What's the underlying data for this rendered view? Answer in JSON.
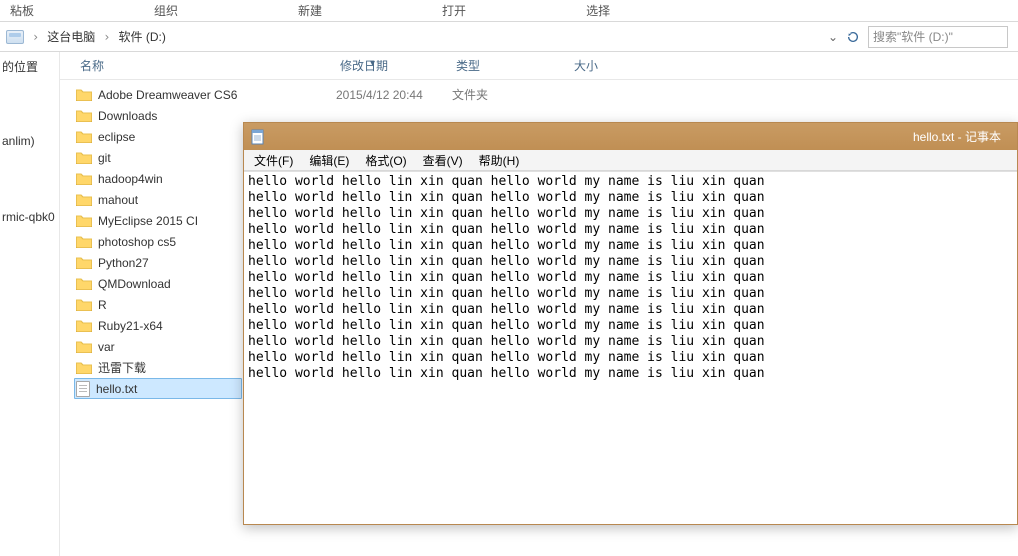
{
  "ribbon": [
    "粘板",
    "组织",
    "新建",
    "打开",
    "选择"
  ],
  "breadcrumb": {
    "a": "这台电脑",
    "b": "软件 (D:)"
  },
  "search_placeholder": "搜索\"软件 (D:)\"",
  "columns": {
    "name": "名称",
    "date": "修改日期",
    "type": "类型",
    "size": "大小"
  },
  "files": [
    {
      "name": "Adobe Dreamweaver CS6",
      "date": "2015/4/12 20:44",
      "type": "文件夹",
      "kind": "folder"
    },
    {
      "name": "Downloads",
      "date": "",
      "type": "",
      "kind": "folder"
    },
    {
      "name": "eclipse",
      "date": "",
      "type": "",
      "kind": "folder"
    },
    {
      "name": "git",
      "date": "",
      "type": "",
      "kind": "folder"
    },
    {
      "name": "hadoop4win",
      "date": "",
      "type": "",
      "kind": "folder"
    },
    {
      "name": "mahout",
      "date": "",
      "type": "",
      "kind": "folder"
    },
    {
      "name": "MyEclipse 2015 CI",
      "date": "",
      "type": "",
      "kind": "folder"
    },
    {
      "name": "photoshop cs5",
      "date": "",
      "type": "",
      "kind": "folder"
    },
    {
      "name": "Python27",
      "date": "",
      "type": "",
      "kind": "folder"
    },
    {
      "name": "QMDownload",
      "date": "",
      "type": "",
      "kind": "folder"
    },
    {
      "name": "R",
      "date": "",
      "type": "",
      "kind": "folder"
    },
    {
      "name": "Ruby21-x64",
      "date": "",
      "type": "",
      "kind": "folder"
    },
    {
      "name": "var",
      "date": "",
      "type": "",
      "kind": "folder"
    },
    {
      "name": "迅雷下载",
      "date": "",
      "type": "",
      "kind": "folder"
    },
    {
      "name": "hello.txt",
      "date": "",
      "type": "",
      "kind": "file",
      "selected": true
    }
  ],
  "leftnav": [
    "的位置",
    "anlim)",
    "rmic-qbk0"
  ],
  "notepad": {
    "title": "hello.txt - 记事本",
    "menu": [
      "文件(F)",
      "编辑(E)",
      "格式(O)",
      "查看(V)",
      "帮助(H)"
    ],
    "line": "hello world hello lin xin quan hello world my name is liu xin quan",
    "line_count": 13
  }
}
